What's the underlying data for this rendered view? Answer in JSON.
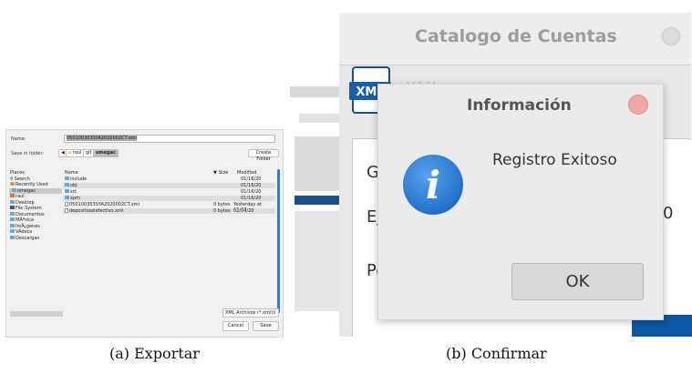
{
  "panel_a": {
    "name_label": "Name:",
    "name_value": "050100303SYA2020002CT.xml",
    "save_in_label": "Save in folder:",
    "breadcrumb": {
      "back": "◀",
      "raul": "raul",
      "git": "git",
      "current": "omegac"
    },
    "create_folder": "Create Folder",
    "places_header": "Places",
    "places": [
      {
        "label": "Search",
        "icon": "search-icon"
      },
      {
        "label": "Recently Used",
        "icon": "clock-icon"
      },
      {
        "label": "omegac",
        "icon": "folder-icon",
        "selected": true
      },
      {
        "label": "raul",
        "icon": "home-icon"
      },
      {
        "label": "Desktop",
        "icon": "folder-icon"
      },
      {
        "label": "File System",
        "icon": "drive-icon"
      },
      {
        "label": "Documentos",
        "icon": "folder-icon"
      },
      {
        "label": "MÃºsica",
        "icon": "folder-icon"
      },
      {
        "label": "ImÃ¡genes",
        "icon": "folder-icon"
      },
      {
        "label": "VÃ­deos",
        "icon": "folder-icon"
      },
      {
        "label": "Descargas",
        "icon": "folder-icon"
      }
    ],
    "columns": {
      "name": "Name",
      "size": "Size",
      "modified": "Modified",
      "sort_arrow": "▼"
    },
    "files": [
      {
        "name": "include",
        "type": "folder",
        "size": "",
        "modified": "01/16/20"
      },
      {
        "name": "obj",
        "type": "folder",
        "size": "",
        "modified": "01/16/20"
      },
      {
        "name": "src",
        "type": "folder",
        "size": "",
        "modified": "01/16/20"
      },
      {
        "name": "xpm",
        "type": "folder",
        "size": "",
        "modified": "01/16/20"
      },
      {
        "name": "050100303SYA2020002CT.xml",
        "type": "file",
        "size": "0 bytes",
        "modified": "Yesterday at 19:07"
      },
      {
        "name": "depositoselefectivo.xml",
        "type": "file",
        "size": "0 bytes",
        "modified": "02/04/20"
      }
    ],
    "filter": "XML Archivos (*.xml)",
    "cancel": "Cancel",
    "save": "Save"
  },
  "panel_b": {
    "window_title": "Catalogo de Cuentas",
    "xml_icon_text": "XML",
    "xml_side_label": "XML",
    "bg_labels": [
      "Ge",
      "Eje",
      "Pe"
    ],
    "bg_value": "0",
    "dialog": {
      "title": "Información",
      "message": "Registro Exitoso",
      "ok": "OK",
      "icon_glyph": "i"
    }
  },
  "captions": {
    "a": "(a)  Exportar",
    "b": "(b)  Confirmar"
  },
  "colors": {
    "accent_blue": "#2f7fd3",
    "info_blue": "#1f6fc9",
    "close_red": "#f2a6a6",
    "dark_blue": "#0b57a3"
  }
}
